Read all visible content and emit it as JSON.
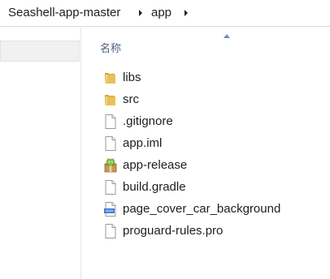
{
  "breadcrumb": {
    "items": [
      "Seashell-app-master",
      "app"
    ]
  },
  "column_header": {
    "name_label": "名称"
  },
  "files": [
    {
      "name": "libs",
      "icon": "folder-icon"
    },
    {
      "name": "src",
      "icon": "folder-icon"
    },
    {
      "name": ".gitignore",
      "icon": "file-icon"
    },
    {
      "name": "app.iml",
      "icon": "file-icon"
    },
    {
      "name": "app-release",
      "icon": "android-package-icon"
    },
    {
      "name": "build.gradle",
      "icon": "file-icon"
    },
    {
      "name": "page_cover_car_background",
      "icon": "image-file-icon"
    },
    {
      "name": "proguard-rules.pro",
      "icon": "file-icon"
    }
  ],
  "colors": {
    "folder_yellow": "#e8c15a",
    "folder_dark": "#d4a630",
    "header_text": "#4c607a",
    "sort_arrow": "#6f8db5"
  }
}
